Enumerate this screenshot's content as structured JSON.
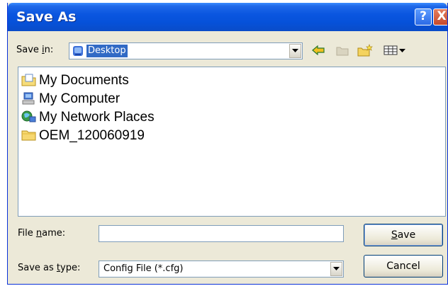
{
  "window": {
    "title": "Save As",
    "help_glyph": "?",
    "close_glyph": "X"
  },
  "save_in": {
    "label_pre": "Save ",
    "label_mnemonic": "i",
    "label_post": "n:",
    "value": "Desktop",
    "icon": "desktop-icon"
  },
  "toolbar": {
    "items": [
      "back-arrow-icon",
      "up-folder-icon",
      "new-folder-icon",
      "view-menu-icon"
    ]
  },
  "files": [
    {
      "label": "My Documents",
      "icon": "my-documents-folder-icon"
    },
    {
      "label": "My Computer",
      "icon": "my-computer-icon"
    },
    {
      "label": "My Network Places",
      "icon": "network-places-icon"
    },
    {
      "label": "OEM_120060919",
      "icon": "folder-icon"
    }
  ],
  "file_name": {
    "label_pre": "File ",
    "label_mnemonic": "n",
    "label_post": "ame:",
    "value": ""
  },
  "save_as_type": {
    "label_pre": "Save as ",
    "label_mnemonic": "t",
    "label_post": "ype:",
    "value": "Config File (*.cfg)"
  },
  "buttons": {
    "save_mnemonic": "S",
    "save_rest": "ave",
    "cancel": "Cancel"
  },
  "colors": {
    "title_blue": "#0651d9",
    "dialog_bg": "#ece9d8",
    "selection": "#316ac5",
    "close_red": "#c74a2c"
  }
}
